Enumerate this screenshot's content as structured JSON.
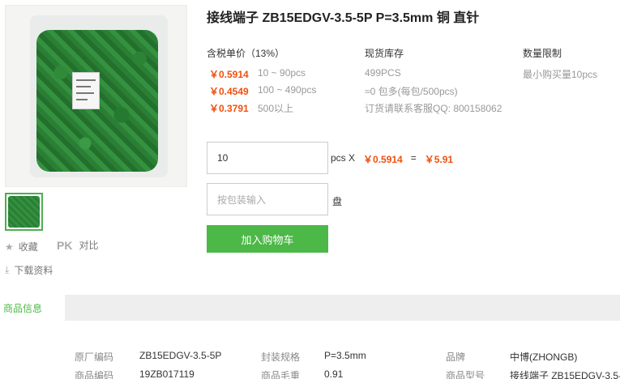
{
  "product": {
    "title": "接线端子 ZB15EDGV-3.5-5P P=3.5mm 铜 直针"
  },
  "actions": {
    "favorite_label": "收藏",
    "pk_label": "PK",
    "compare_label": "对比",
    "download_label": "下载资料"
  },
  "pricing": {
    "header": "含税单价（13%）",
    "tiers": [
      {
        "price": "￥0.5914",
        "range": "10 ~ 90pcs"
      },
      {
        "price": "￥0.4549",
        "range": "100 ~ 490pcs"
      },
      {
        "price": "￥0.3791",
        "range": "500以上"
      }
    ]
  },
  "stock": {
    "header": "现货库存",
    "lines": [
      "499PCS",
      "≈0 包多(每包/500pcs)",
      "订货请联系客服QQ: 800158062"
    ]
  },
  "limit": {
    "header": "数量限制",
    "text": "最小购买量10pcs"
  },
  "order": {
    "quantity_value": "10",
    "unit_x": "pcs X",
    "unit_price": "￥0.5914",
    "equals": "=",
    "total": "￥5.91",
    "package_placeholder": "按包装输入",
    "package_unit": "盘",
    "add_to_cart": "加入购物车"
  },
  "tabs": {
    "active": "商品信息"
  },
  "specs": {
    "row1": [
      {
        "label": "原厂编码",
        "value": "ZB15EDGV-3.5-5P"
      },
      {
        "label": "封装规格",
        "value": "P=3.5mm"
      },
      {
        "label": "品牌",
        "value": "中博(ZHONGB)"
      }
    ],
    "row2": [
      {
        "label": "商品编码",
        "value": "19ZB017119"
      },
      {
        "label": "商品毛重",
        "value": "0.91"
      },
      {
        "label": "商品型号",
        "value": "接线端子 ZB15EDGV-3.5-"
      }
    ]
  },
  "colors": {
    "accent_green": "#4cb847",
    "price_orange": "#f0500f"
  },
  "icons": {
    "favorite": "star-icon",
    "download": "download-icon"
  }
}
